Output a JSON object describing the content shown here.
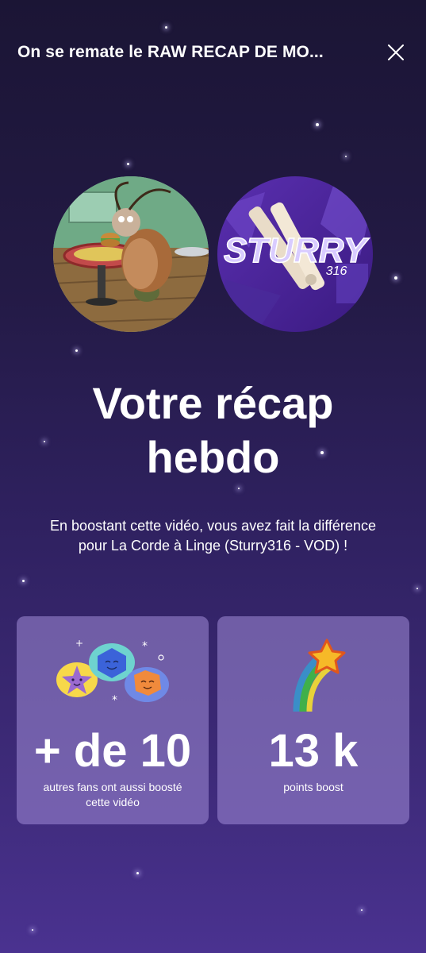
{
  "header": {
    "title": "On se remate le RAW RECAP DE MO..."
  },
  "recap": {
    "title_line1": "Votre récap",
    "title_line2": "hebdo",
    "description_line1": "En boostant cette vidéo, vous avez fait la différence",
    "description_line2": "pour La Corde à Linge (Sturry316 - VOD) !"
  },
  "avatars": {
    "right_logo_text": "STURRY",
    "right_logo_sub": "316"
  },
  "stats": [
    {
      "value": "+ de 10",
      "label_line1": "autres fans ont aussi boosté",
      "label_line2": "cette vidéo",
      "icon": "fans-group-icon"
    },
    {
      "value": "13 k",
      "label_line1": "points boost",
      "icon": "shooting-star-icon"
    }
  ],
  "colors": {
    "background_top": "#1b1535",
    "background_bottom": "#4a3290",
    "card": "#8f7fc8",
    "text": "#ffffff"
  }
}
